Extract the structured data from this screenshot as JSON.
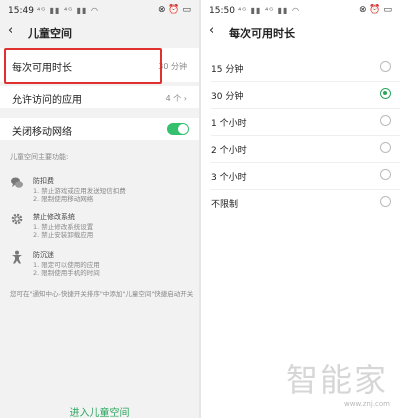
{
  "left": {
    "status": {
      "time": "15:49",
      "signal_icons": "⁴ᴳ ▮▮ ⁴ᴳ ▮▮ ◠",
      "right_icons": "⊗ ⏰ ▭"
    },
    "header": {
      "back_icon": "‹",
      "title": "儿童空间"
    },
    "rows": {
      "time_limit": {
        "label": "每次可用时长",
        "value": "30 分钟"
      },
      "allowed_apps": {
        "label": "允许访问的应用",
        "value": "4 个 ›"
      },
      "mobile_network": {
        "label": "关闭移动网络",
        "enabled": true
      }
    },
    "info": {
      "heading": "儿童空间主要功能:",
      "features": [
        {
          "icon": "chat-bubble-icon",
          "title": "防扣费",
          "lines": [
            "1. 禁止游戏或应用发送短信扣费",
            "2. 限制使用移动网络"
          ]
        },
        {
          "icon": "gear-icon",
          "title": "禁止修改系统",
          "lines": [
            "1. 禁止修改系统设置",
            "2. 禁止安装卸载应用"
          ]
        },
        {
          "icon": "child-figure-icon",
          "title": "防沉迷",
          "lines": [
            "1. 限定可以使用的应用",
            "2. 限制使用手机的时间"
          ]
        }
      ],
      "footnote": "您可在\"通知中心-快捷开关排序\"中添加\"儿童空间\"快捷启动开关"
    },
    "enter_button": "进入儿童空间"
  },
  "right": {
    "status": {
      "time": "15:50",
      "signal_icons": "⁴ᴳ ▮▮ ⁴ᴳ ▮▮ ◠",
      "right_icons": "⊗ ⏰ ▭"
    },
    "header": {
      "back_icon": "‹",
      "title": "每次可用时长"
    },
    "options": [
      {
        "label": "15 分钟",
        "selected": false
      },
      {
        "label": "30 分钟",
        "selected": true
      },
      {
        "label": "1 个小时",
        "selected": false
      },
      {
        "label": "2 个小时",
        "selected": false
      },
      {
        "label": "3 个小时",
        "selected": false
      },
      {
        "label": "不限制",
        "selected": false
      }
    ]
  },
  "watermark": {
    "brand": "智能家",
    "url": "www.znj.com"
  },
  "colors": {
    "accent": "#2ba55e",
    "highlight": "#e03030"
  }
}
